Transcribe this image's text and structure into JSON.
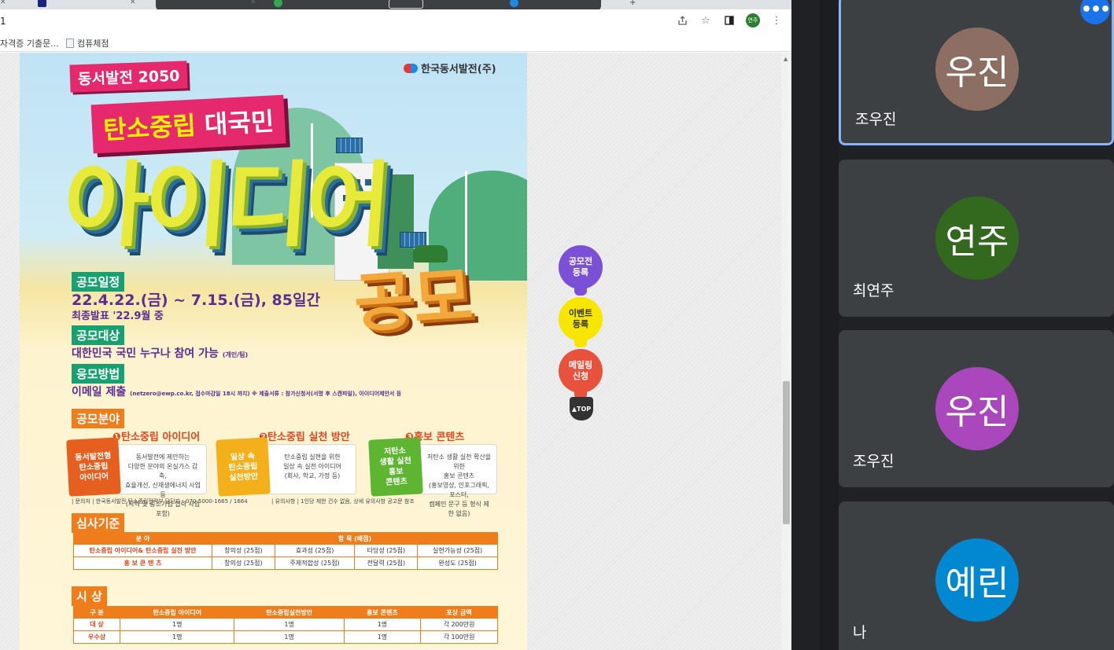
{
  "browser": {
    "url": "1",
    "tabs": [
      "",
      "",
      "",
      "",
      ""
    ],
    "bookmarks": [
      "자격증 기출문...",
      "컴퓨체점"
    ],
    "profile_label": "연주",
    "icons": [
      "share-icon",
      "star-icon",
      "sidepanel-icon",
      "profile-avatar",
      "kebab-menu-icon"
    ]
  },
  "poster": {
    "tag1": "동서발전 2050",
    "tag2_a": "탄소중립",
    "tag2_b": " 대국민",
    "title_main": "아이디어",
    "title_sub": "공모",
    "org": "한국동서발전(주)",
    "schedule_label": "공모일정",
    "schedule_line1": "22.4.22.(금) ~ 7.15.(금), 85일간",
    "schedule_line2": "최종발표 '22.9월 중",
    "target_label": "공모대상",
    "target_text": "대한민국 국민 누구나 참여 가능",
    "target_note": "(개인/팀)",
    "method_label": "응모방법",
    "method_text": "이메일 제출",
    "method_note": "(netzero@ewp.co.kr, 접수마감일 18시 까지)  ※ 제출서류 : 참가신청서(서명 후 스캔파일), 아이디어제안서 등",
    "field_label": "공모분야",
    "fields": [
      {
        "title": "❶탄소중립 아이디어",
        "tag": "동서발전형\n탄소중립\n아이디어",
        "desc": "동서발전에 제안하는\n다양한 분야의 온실가스 감축,\n효율개선, 신재생에너지 사업 등\n(지역 및 중소기업 협력 사업 포함)"
      },
      {
        "title": "❷탄소중립 실천 방안",
        "tag": "일상 속\n탄소중립\n실천방안",
        "desc": "탄소중립 실현을 위한\n일상 속 실천 아이디어\n(회사, 학교, 가정 등)"
      },
      {
        "title": "❸홍보 콘텐츠",
        "tag": "저탄소\n생활 실천\n홍보\n콘텐츠",
        "desc": "저탄소 생활 실천 확산을 위한\n홍보 콘텐츠\n(홍보영상, 인포그래픽, 포스터,\n캠페인 문구 등 형식 제한 없음)"
      }
    ],
    "footnote1": "| 문의처 | 한국동서발전 탄소중립전략부 담당자 : 070-5000-1665 / 1664",
    "footnote2": "| 유의사항 | 1인당 제한 건수 없음, 상세 유의사항 공고문 참조",
    "judge_label": "심사기준",
    "judge_headers": [
      "분   야",
      "항   목 (배점)"
    ],
    "judge_rows": [
      {
        "field": "탄소중립 아이디어& 탄소중립 실천 방안",
        "items": [
          "창의성 (25점)",
          "효과성 (25점)",
          "타당성 (25점)",
          "실현가능성 (25점)"
        ]
      },
      {
        "field": "홍 보   콘 텐 츠",
        "items": [
          "창의성 (25점)",
          "주제적합성 (25점)",
          "전달력 (25점)",
          "완성도 (25점)"
        ]
      }
    ],
    "award_label": "시   상",
    "award_headers": [
      "구   분",
      "탄소중립 아이디어",
      "탄소중립실천방안",
      "홍보 콘텐츠",
      "포상 금액"
    ],
    "award_rows": [
      [
        "대   상",
        "1명",
        "1명",
        "1명",
        "각 200만원"
      ],
      [
        "우수상",
        "1명",
        "1명",
        "1명",
        "각 100만원"
      ]
    ]
  },
  "sidemenu": {
    "items": [
      "공모전\n등록",
      "이벤트\n등록",
      "메일링\n신청"
    ],
    "top": "▲TOP"
  },
  "meet": {
    "participants": [
      {
        "initials": "우진",
        "name": "조우진",
        "color": "#8d6e63"
      },
      {
        "initials": "연주",
        "name": "최연주",
        "color": "#33691e"
      },
      {
        "initials": "우진",
        "name": "조우진",
        "color": "#ab47bc"
      },
      {
        "initials": "예린",
        "name": "나",
        "color": "#0288d1"
      }
    ],
    "more_label": "•••"
  }
}
